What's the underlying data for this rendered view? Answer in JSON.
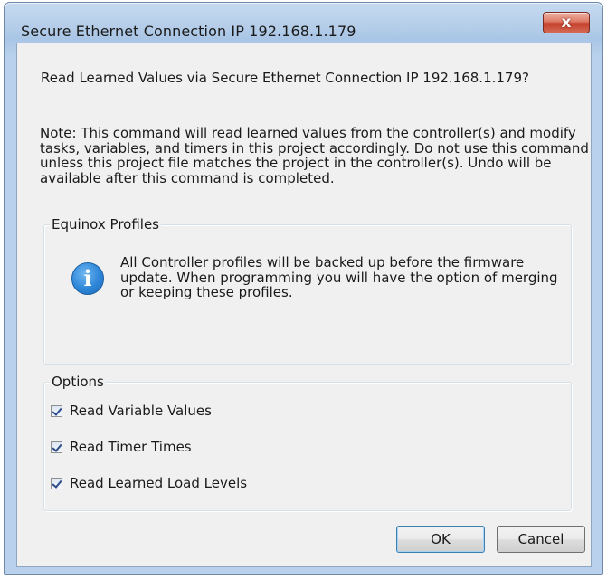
{
  "window": {
    "title": "Secure Ethernet Connection IP 192.168.1.179",
    "close_glyph": "x"
  },
  "dialog": {
    "question": "Read Learned Values via Secure Ethernet Connection IP 192.168.1.179?",
    "note_lines": [
      "Note:  This command will read learned values from the controller(s) and modify",
      "tasks, variables, and timers in this project accordingly.  Do not use this command",
      "unless this project file matches the project in the controller(s).  Undo will be",
      "available after this command is completed."
    ]
  },
  "profiles": {
    "label": "Equinox Profiles",
    "icon": "info-icon",
    "icon_glyph": "i",
    "text_lines": [
      "All Controller profiles will be backed up before the firmware",
      "update. When programming you will have the option of merging",
      "or keeping these profiles."
    ]
  },
  "options": {
    "label": "Options",
    "items": [
      {
        "label": "Read Variable Values",
        "checked": true
      },
      {
        "label": "Read Timer Times",
        "checked": true
      },
      {
        "label": "Read Learned Load Levels",
        "checked": true
      }
    ]
  },
  "buttons": {
    "ok": "OK",
    "cancel": "Cancel"
  },
  "colors": {
    "close_button": "#c4402c",
    "info_icon": "#2e86d8",
    "default_button_border": "#3c7fb1"
  }
}
